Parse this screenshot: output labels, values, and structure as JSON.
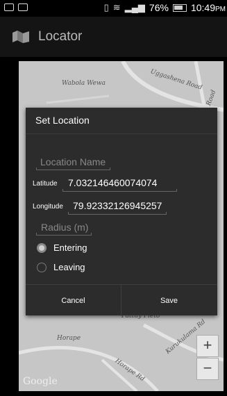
{
  "status": {
    "battery": "76%",
    "time": "10:49",
    "ampm": "PM"
  },
  "app": {
    "title": "Locator",
    "icon": "map-icon"
  },
  "map": {
    "labels": [
      "Wabola Wewa",
      "Uggashena Road",
      "Road",
      "Pattuy Pieto",
      "Horape",
      "Kurukulama Rd",
      "Horape Rd"
    ],
    "zoom_in": "+",
    "zoom_out": "−",
    "attribution": "Google"
  },
  "dialog": {
    "title": "Set Location",
    "location_name_placeholder": "Location Name",
    "latitude_label": "Latitude",
    "latitude_value": "7.032146460074074",
    "longitude_label": "Longitude",
    "longitude_value": "79.92332126945257",
    "radius_placeholder": "Radius (m)",
    "options": [
      {
        "label": "Entering",
        "selected": true
      },
      {
        "label": "Leaving",
        "selected": false
      }
    ],
    "cancel_label": "Cancel",
    "save_label": "Save"
  }
}
